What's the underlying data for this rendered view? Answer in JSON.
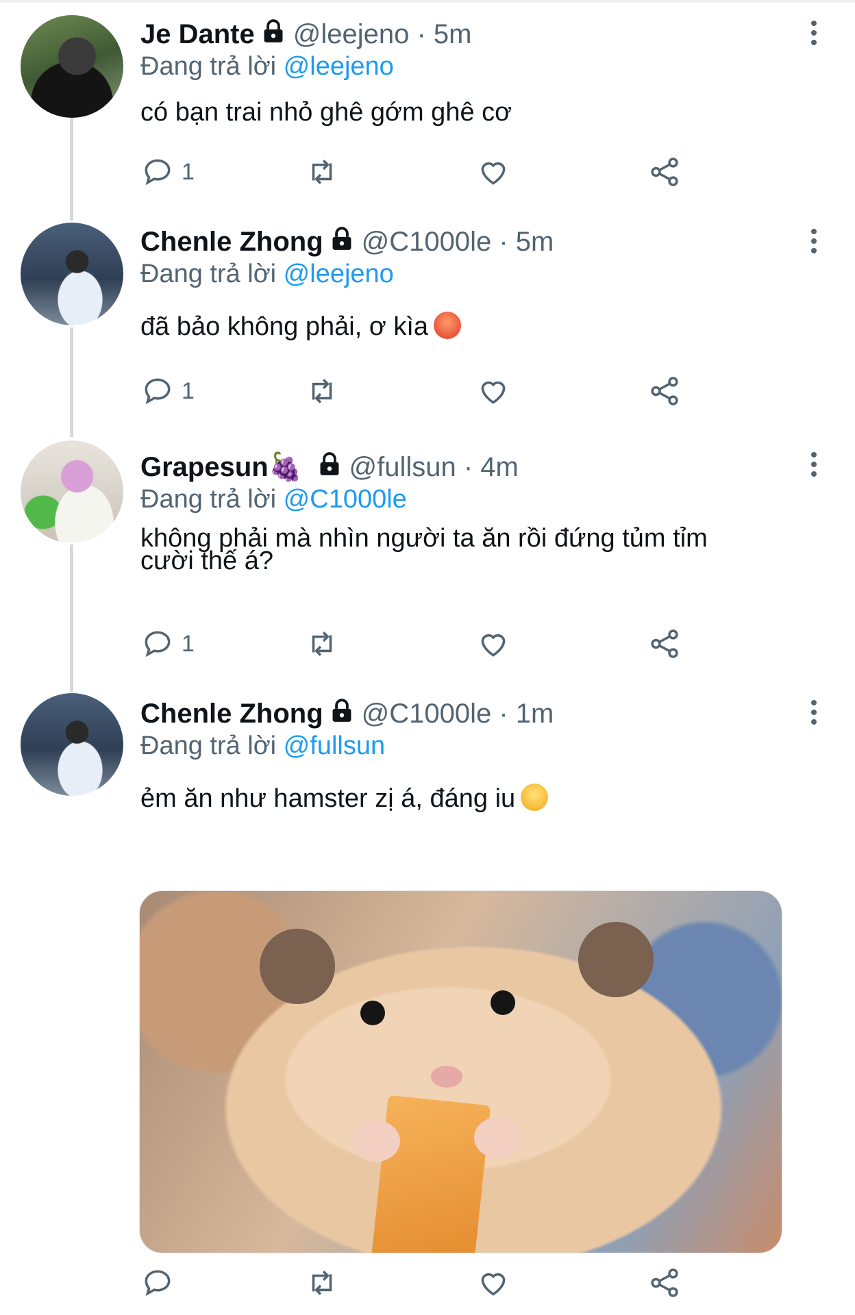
{
  "tweets": [
    {
      "name": "Je Dante",
      "handle": "@leejeno · 5m",
      "reply_prefix": "Đang trả lời",
      "reply_to": "@leejeno",
      "text": "có bạn trai nhỏ ghê gớm ghê cơ",
      "reply_count": "1"
    },
    {
      "name": "Chenle Zhong",
      "handle": "@C1000le · 5m",
      "reply_prefix": "Đang trả lời",
      "reply_to": "@leejeno",
      "text": "đã bảo không phải, ơ kìa",
      "emoji": "angry-face",
      "reply_count": "1"
    },
    {
      "name": "Grapesun🍇",
      "handle": "@fullsun · 4m",
      "reply_prefix": "Đang trả lời",
      "reply_to": "@C1000le",
      "text_line1": "không phải mà nhìn người ta ăn rồi đứng tủm tỉm",
      "text_line2": "cười thế á?",
      "reply_count": "1"
    },
    {
      "name": "Chenle Zhong",
      "handle": "@C1000le · 1m",
      "reply_prefix": "Đang trả lời",
      "reply_to": "@fullsun",
      "text": "ẻm ăn như hamster zị á, đáng iu",
      "emoji": "yum-face",
      "media": "hamster-photo"
    }
  ],
  "icons": {
    "reply": "reply-icon",
    "retweet": "retweet-icon",
    "like": "heart-icon",
    "share": "share-icon",
    "lock": "lock-icon",
    "more": "more-vertical-icon"
  },
  "colors": {
    "accent": "#1d9bf0",
    "secondary_text": "#536471",
    "thread_line": "#d4dade"
  }
}
